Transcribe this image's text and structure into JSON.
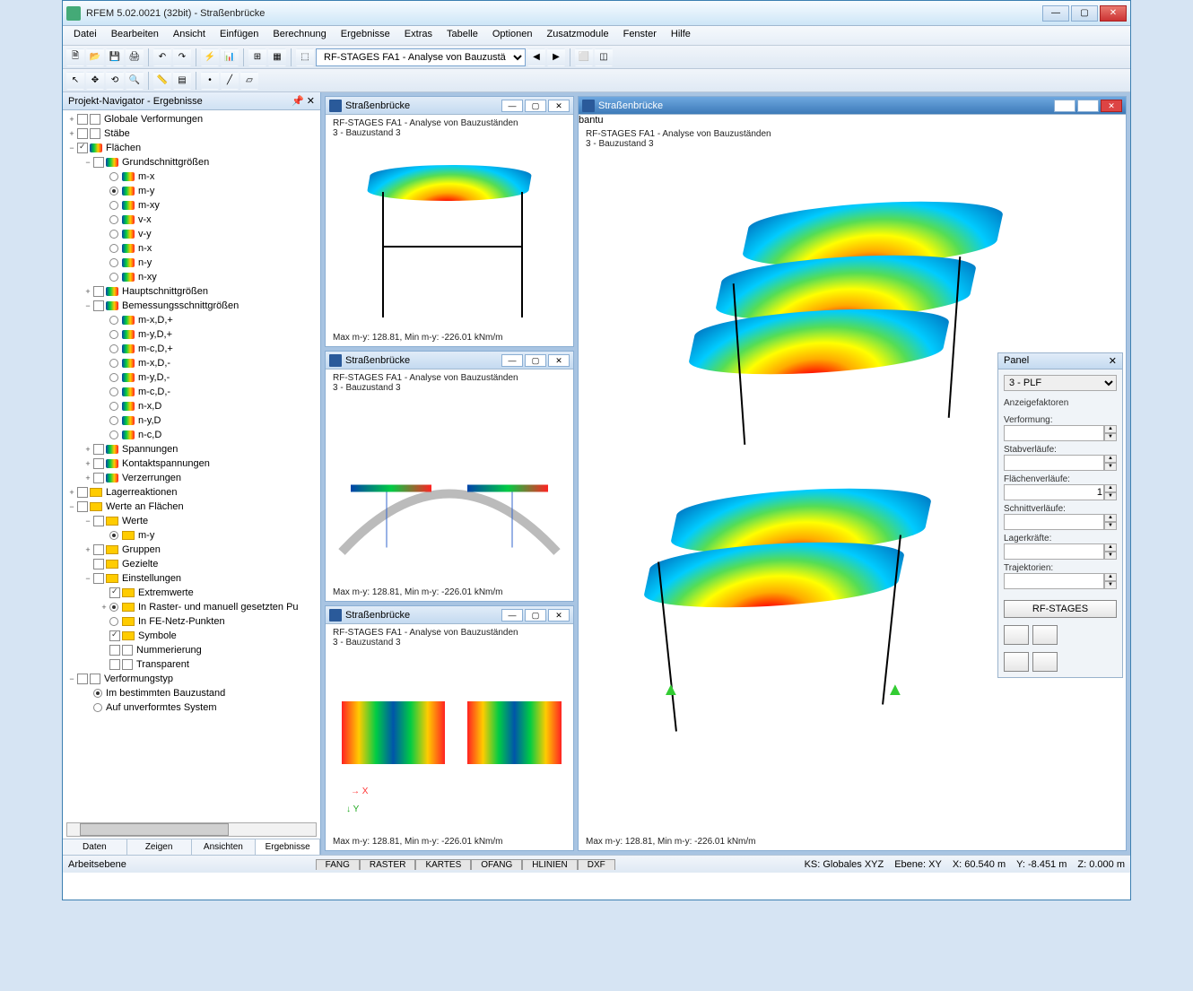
{
  "app": {
    "title": "RFEM 5.02.0021 (32bit) - Straßenbrücke"
  },
  "menubar": [
    "Datei",
    "Bearbeiten",
    "Ansicht",
    "Einfügen",
    "Berechnung",
    "Ergebnisse",
    "Extras",
    "Tabelle",
    "Optionen",
    "Zusatzmodule",
    "Fenster",
    "Hilfe"
  ],
  "toolbar_select": "RF-STAGES FA1 - Analyse von Bauzustä",
  "navigator": {
    "title": "Projekt-Navigator - Ergebnisse",
    "tabs": [
      "Daten",
      "Zeigen",
      "Ansichten",
      "Ergebnisse"
    ],
    "tree": [
      {
        "d": 0,
        "exp": "+",
        "chk": 0,
        "ic": "box",
        "label": "Globale Verformungen"
      },
      {
        "d": 0,
        "exp": "+",
        "chk": 0,
        "ic": "box",
        "label": "Stäbe"
      },
      {
        "d": 0,
        "exp": "−",
        "chk": 1,
        "ic": "rainbow",
        "label": "Flächen"
      },
      {
        "d": 1,
        "exp": "−",
        "chk": 0,
        "ic": "rainbow",
        "label": "Grundschnittgrößen"
      },
      {
        "d": 2,
        "radio": 0,
        "ic": "rainbow",
        "label": "m-x"
      },
      {
        "d": 2,
        "radio": 1,
        "ic": "rainbow",
        "label": "m-y"
      },
      {
        "d": 2,
        "radio": 0,
        "ic": "rainbow",
        "label": "m-xy"
      },
      {
        "d": 2,
        "radio": 0,
        "ic": "rainbow",
        "label": "v-x"
      },
      {
        "d": 2,
        "radio": 0,
        "ic": "rainbow",
        "label": "v-y"
      },
      {
        "d": 2,
        "radio": 0,
        "ic": "rainbow",
        "label": "n-x"
      },
      {
        "d": 2,
        "radio": 0,
        "ic": "rainbow",
        "label": "n-y"
      },
      {
        "d": 2,
        "radio": 0,
        "ic": "rainbow",
        "label": "n-xy"
      },
      {
        "d": 1,
        "exp": "+",
        "chk": 0,
        "ic": "rainbow",
        "label": "Hauptschnittgrößen"
      },
      {
        "d": 1,
        "exp": "−",
        "chk": 0,
        "ic": "rainbow",
        "label": "Bemessungsschnittgrößen"
      },
      {
        "d": 2,
        "radio": 0,
        "ic": "rainbow",
        "label": "m-x,D,+"
      },
      {
        "d": 2,
        "radio": 0,
        "ic": "rainbow",
        "label": "m-y,D,+"
      },
      {
        "d": 2,
        "radio": 0,
        "ic": "rainbow",
        "label": "m-c,D,+"
      },
      {
        "d": 2,
        "radio": 0,
        "ic": "rainbow",
        "label": "m-x,D,-"
      },
      {
        "d": 2,
        "radio": 0,
        "ic": "rainbow",
        "label": "m-y,D,-"
      },
      {
        "d": 2,
        "radio": 0,
        "ic": "rainbow",
        "label": "m-c,D,-"
      },
      {
        "d": 2,
        "radio": 0,
        "ic": "rainbow",
        "label": "n-x,D"
      },
      {
        "d": 2,
        "radio": 0,
        "ic": "rainbow",
        "label": "n-y,D"
      },
      {
        "d": 2,
        "radio": 0,
        "ic": "rainbow",
        "label": "n-c,D"
      },
      {
        "d": 1,
        "exp": "+",
        "chk": 0,
        "ic": "rainbow",
        "label": "Spannungen"
      },
      {
        "d": 1,
        "exp": "+",
        "chk": 0,
        "ic": "rainbow",
        "label": "Kontaktspannungen"
      },
      {
        "d": 1,
        "exp": "+",
        "chk": 0,
        "ic": "rainbow",
        "label": "Verzerrungen"
      },
      {
        "d": 0,
        "exp": "+",
        "chk": 0,
        "ic": "yellow",
        "label": "Lagerreaktionen"
      },
      {
        "d": 0,
        "exp": "−",
        "chk": 0,
        "ic": "yellow",
        "label": "Werte an Flächen"
      },
      {
        "d": 1,
        "exp": "−",
        "chk": 0,
        "ic": "yellow",
        "label": "Werte"
      },
      {
        "d": 2,
        "radio": 1,
        "ic": "yellow",
        "label": "m-y"
      },
      {
        "d": 1,
        "exp": "+",
        "chk": 0,
        "ic": "yellow",
        "label": "Gruppen"
      },
      {
        "d": 1,
        "chk": 0,
        "ic": "yellow",
        "label": "Gezielte"
      },
      {
        "d": 1,
        "exp": "−",
        "chk": 0,
        "ic": "yellow",
        "label": "Einstellungen"
      },
      {
        "d": 2,
        "chk": 1,
        "ic": "yellow",
        "label": "Extremwerte"
      },
      {
        "d": 2,
        "exp": "+",
        "radio": 1,
        "ic": "yellow",
        "label": "In Raster- und manuell gesetzten Pu"
      },
      {
        "d": 2,
        "radio": 0,
        "ic": "yellow",
        "label": "In FE-Netz-Punkten"
      },
      {
        "d": 2,
        "chk": 1,
        "ic": "yellow",
        "label": "Symbole"
      },
      {
        "d": 2,
        "chk": 0,
        "ic": "box",
        "label": "Nummerierung"
      },
      {
        "d": 2,
        "chk": 0,
        "ic": "box",
        "label": "Transparent"
      },
      {
        "d": 0,
        "exp": "−",
        "chk": 0,
        "ic": "box",
        "label": "Verformungstyp"
      },
      {
        "d": 1,
        "radio": 1,
        "label": "Im bestimmten Bauzustand"
      },
      {
        "d": 1,
        "radio": 0,
        "label": "Auf unverformtes System"
      }
    ]
  },
  "children": {
    "title": "Straßenbrücke",
    "info1": "RF-STAGES FA1 - Analyse von Bauzuständen",
    "info2": "3 - Bauzustand 3",
    "status": "Max m-y: 128.81, Min m-y: -226.01 kNm/m"
  },
  "panel": {
    "title": "Panel",
    "select": "3 - PLF",
    "groupTitle": "Anzeigefaktoren",
    "fields": [
      {
        "label": "Verformung:",
        "val": ""
      },
      {
        "label": "Stabverläufe:",
        "val": ""
      },
      {
        "label": "Flächenverläufe:",
        "val": "1"
      },
      {
        "label": "Schnittverläufe:",
        "val": ""
      },
      {
        "label": "Lagerkräfte:",
        "val": ""
      },
      {
        "label": "Trajektorien:",
        "val": ""
      }
    ],
    "button": "RF-STAGES"
  },
  "statusbar": {
    "left": "Arbeitsebene",
    "tabs": [
      "FANG",
      "RASTER",
      "KARTES",
      "OFANG",
      "HLINIEN",
      "DXF"
    ],
    "ks": "KS: Globales XYZ",
    "ebene": "Ebene: XY",
    "x": "X: 60.540 m",
    "y": "Y: -8.451 m",
    "z": "Z: 0.000 m"
  }
}
